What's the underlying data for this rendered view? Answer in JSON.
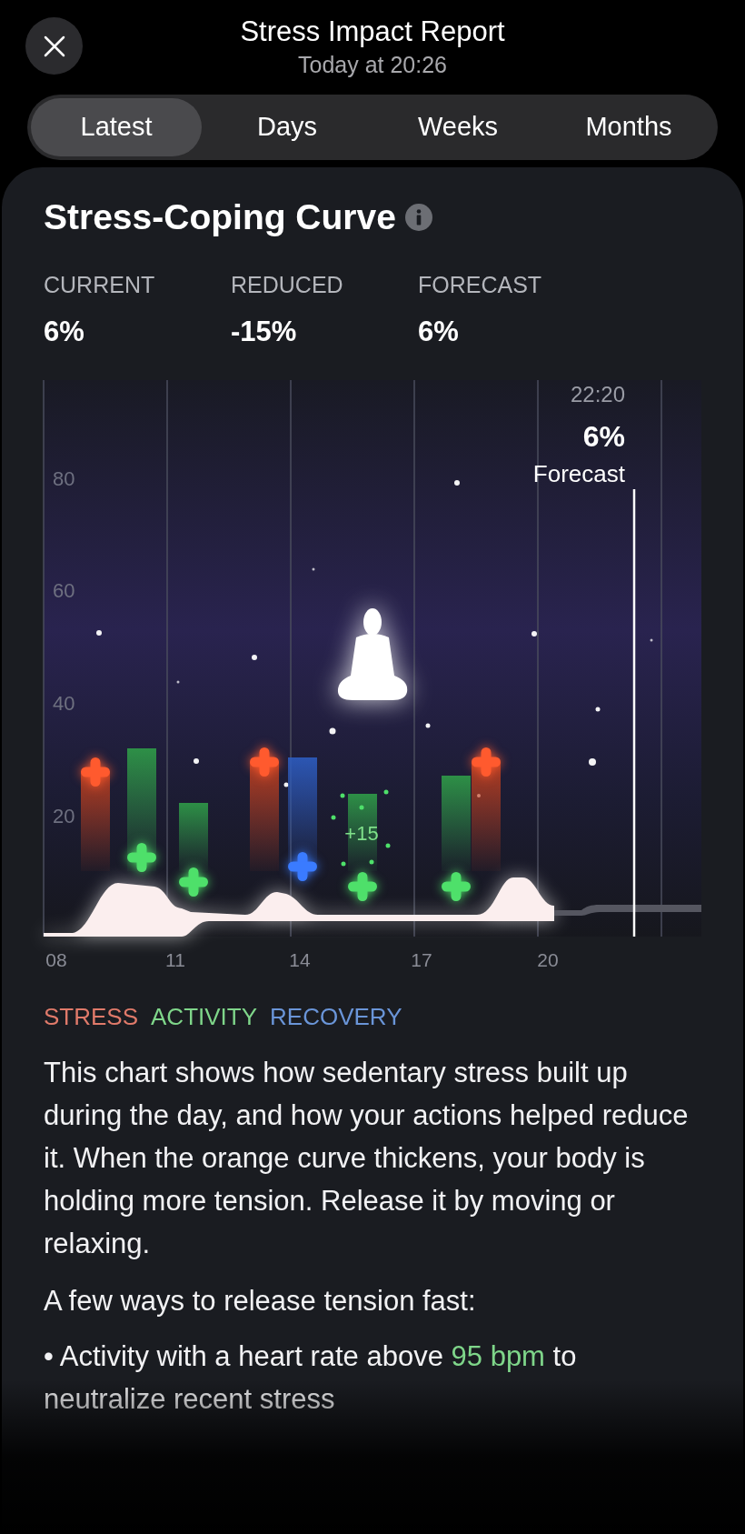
{
  "header": {
    "title": "Stress Impact Report",
    "subtitle": "Today at 20:26"
  },
  "tabs": [
    {
      "label": "Latest",
      "selected": true
    },
    {
      "label": "Days",
      "selected": false
    },
    {
      "label": "Weeks",
      "selected": false
    },
    {
      "label": "Months",
      "selected": false
    }
  ],
  "card": {
    "title": "Stress-Coping Curve",
    "stats": [
      {
        "label": "CURRENT",
        "value": "6%"
      },
      {
        "label": "REDUCED",
        "value": "-15%"
      },
      {
        "label": "FORECAST",
        "value": "6%"
      }
    ],
    "chart": {
      "y_labels": [
        "80",
        "60",
        "40",
        "20"
      ],
      "x_labels": [
        "08",
        "11",
        "14",
        "17",
        "20"
      ],
      "forecast": {
        "time": "22:20",
        "value": "6%",
        "label": "Forecast"
      },
      "gain_label": "+15",
      "events": [
        {
          "kind": "stress"
        },
        {
          "kind": "activity"
        },
        {
          "kind": "activity"
        },
        {
          "kind": "stress"
        },
        {
          "kind": "recovery"
        },
        {
          "kind": "activity"
        },
        {
          "kind": "activity"
        },
        {
          "kind": "stress"
        }
      ]
    },
    "legend": [
      {
        "label": "STRESS",
        "color": "#e07a6a"
      },
      {
        "label": "ACTIVITY",
        "color": "#7fd68a"
      },
      {
        "label": "RECOVERY",
        "color": "#6a95d8"
      }
    ],
    "description": "This chart shows how sedentary stress built up during the day, and how your actions helped reduce it. When the orange curve thickens, your body is holding more tension. Release it by moving or relaxing.",
    "tips_heading": "A few ways to release tension fast:",
    "tips": [
      {
        "bullet": "•",
        "before": "Activity with a heart rate above",
        "highlight": "95 bpm",
        "after": "to neutralize recent stress"
      }
    ]
  }
}
